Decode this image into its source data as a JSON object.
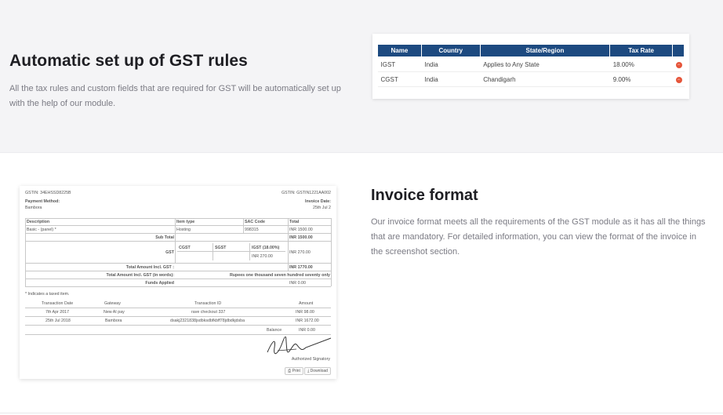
{
  "section1": {
    "heading": "Automatic set up of GST rules",
    "description": "All the tax rules and custom fields that are required for GST will be automatically set up with the help of our module.",
    "tax_table": {
      "headers": [
        "Name",
        "Country",
        "State/Region",
        "Tax Rate"
      ],
      "rows": [
        {
          "name": "IGST",
          "country": "India",
          "state": "Applies to Any State",
          "rate": "18.00%"
        },
        {
          "name": "CGST",
          "country": "India",
          "state": "Chandigarh",
          "rate": "9.00%"
        }
      ],
      "header_color": "#1d4a80",
      "delete_color": "#e6553a"
    }
  },
  "section2": {
    "heading": "Invoice format",
    "description": "Our invoice format meets all the requirements of the GST module as it has all the things that are mandatory. For detailed information, you can view the format of the invoice in the screenshot section."
  },
  "invoice": {
    "gstin_left": "GSTIN: 34EHSSD8225B",
    "gstin_right": "GSTIN: GSTIN1221AA002",
    "payment_method_label": "Payment Method:",
    "payment_method": "Bambora",
    "invoice_date_label": "Invoice Date:",
    "invoice_date": "25th Jul 2",
    "headers": {
      "description": "Description",
      "item_type": "Item type",
      "sac_code": "SAC Code",
      "total": "Total"
    },
    "item": {
      "description": "Basic - (panel) *",
      "item_type": "Hosting",
      "sac_code": "998315",
      "total": "INR 1500.00"
    },
    "sub_total_label": "Sub Total",
    "sub_total": "INR 1500.00",
    "gst_label": "GST",
    "cgst_label": "CGST",
    "sgst_label": "SGST",
    "igst_label": "IGST (18.00%)",
    "igst_value": "INR 270.00",
    "gst_total": "INR 270.00",
    "total_incl_label": "Total Amount Incl. GST :",
    "total_incl": "INR 1770.00",
    "total_words_label": "Total Amount Incl. GST (in words):",
    "total_words": "Rupees one thousand seven hundred seventy only",
    "funds_label": "Funds Applied",
    "funds": "INR 0.00",
    "taxed_note": "* Indicates a taxed item.",
    "txn_headers": {
      "date": "Transaction Date",
      "gateway": "Gateway",
      "id": "Transaction ID",
      "amount": "Amount"
    },
    "transactions": [
      {
        "date": "7th Apr 2017",
        "gateway": "New AI pay",
        "id": "rave checkout 337",
        "amount": "INR 98.00"
      },
      {
        "date": "25th Jul 2018",
        "gateway": "Bambora",
        "id": "dsakj2321838jsdbksdbfkbff78jdbdkjdsba",
        "amount": "INR 1672.00"
      }
    ],
    "balance_label": "Balance",
    "balance": "INR 0.00",
    "signatory": "Authorized Signatory",
    "print_label": "Print",
    "download_label": "Download"
  }
}
